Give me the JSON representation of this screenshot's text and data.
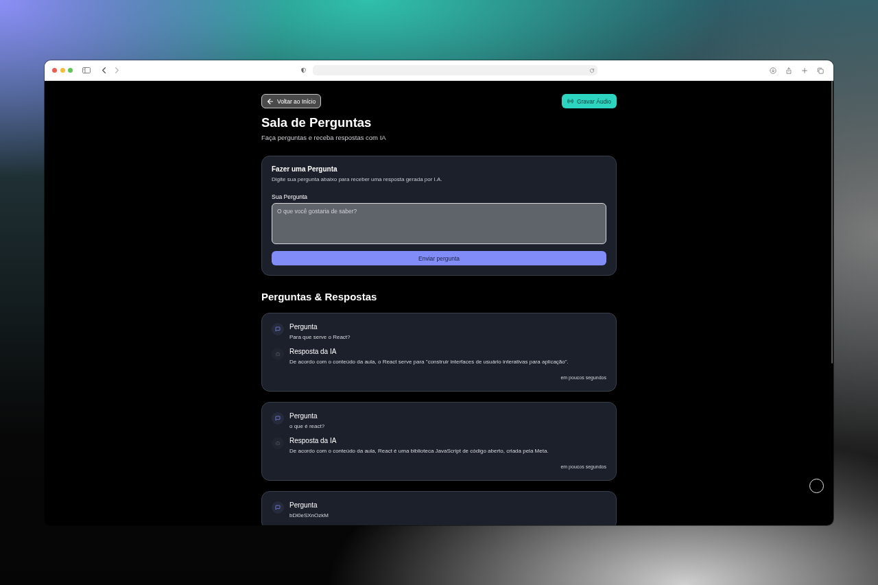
{
  "browser": {
    "nav": [
      {
        "kind": "back",
        "disabled": false
      },
      {
        "kind": "forward",
        "disabled": true
      }
    ]
  },
  "header": {
    "back_button": "Voltar ao Início",
    "record_button": "Gravar Áudio"
  },
  "page": {
    "title": "Sala de Perguntas",
    "subtitle": "Faça perguntas e receba respostas com IA"
  },
  "question_form": {
    "title": "Fazer uma Pergunta",
    "description": "Digite sua pergunta abaixo para receber uma resposta gerada por I.A.",
    "field_label": "Sua Pergunta",
    "placeholder": "O que você gostaria de saber?",
    "submit_button": "Enviar pergunta"
  },
  "qa_section": {
    "title": "Perguntas & Respostas",
    "items": [
      {
        "question_label": "Pergunta",
        "question": "Para que serve o React?",
        "answer_label": "Resposta da IA",
        "answer": "De acordo com o conteúdo da aula, o React serve para \"construir interfaces de usuário interativas para aplicação\".",
        "time": "em poucos segundos"
      },
      {
        "question_label": "Pergunta",
        "question": "o que é react?",
        "answer_label": "Resposta da IA",
        "answer": "De acordo com o conteúdo da aula, React é uma biblioteca JavaScript de código aberto, criada pela Meta.",
        "time": "em poucos segundos"
      },
      {
        "question_label": "Pergunta",
        "question": "bDi0eSXnOzkM"
      }
    ]
  }
}
